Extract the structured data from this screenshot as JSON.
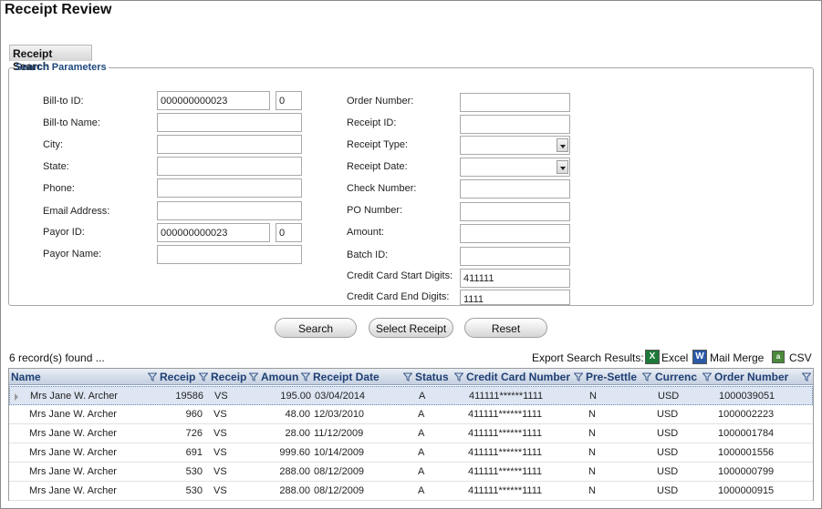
{
  "page": {
    "title": "Receipt Review"
  },
  "tab": {
    "label": "Receipt Search"
  },
  "params": {
    "legend": "Search Parameters",
    "left_fields": [
      {
        "label": "Bill-to ID:",
        "value": "000000000023",
        "sub_value": "0"
      },
      {
        "label": "Bill-to Name:",
        "value": ""
      },
      {
        "label": "City:",
        "value": ""
      },
      {
        "label": "State:",
        "value": ""
      },
      {
        "label": "Phone:",
        "value": ""
      },
      {
        "label": "Email Address:",
        "value": ""
      },
      {
        "label": "Payor ID:",
        "value": "000000000023",
        "sub_value": "0"
      },
      {
        "label": "Payor Name:",
        "value": ""
      }
    ],
    "right_fields": [
      {
        "label": "Order Number:",
        "value": ""
      },
      {
        "label": "Receipt ID:",
        "value": ""
      },
      {
        "label": "Receipt Type:",
        "value": ""
      },
      {
        "label": "Receipt Date:",
        "value": ""
      },
      {
        "label": "Check Number:",
        "value": ""
      },
      {
        "label": "PO Number:",
        "value": ""
      },
      {
        "label": "Amount:",
        "value": ""
      },
      {
        "label": "Batch ID:",
        "value": ""
      },
      {
        "label": "Credit Card Start Digits:",
        "value": "411111"
      },
      {
        "label": "Credit Card End Digits:",
        "value": "1111"
      }
    ]
  },
  "buttons": {
    "search": "Search",
    "select_receipt": "Select Receipt",
    "reset": "Reset"
  },
  "results": {
    "count_text": "6 record(s) found ...",
    "export_label": "Export Search Results:",
    "export_excel": "Excel",
    "export_mail_merge": "Mail Merge",
    "export_csv": "CSV"
  },
  "grid": {
    "columns": [
      "Name",
      "Receip",
      "Receip",
      "Amoun",
      "Receipt Date",
      "Status",
      "Credit Card Number",
      "Pre-Settle",
      "Currenc",
      "Order Number"
    ],
    "rows": [
      [
        "Mrs Jane W. Archer",
        "19586",
        "VS",
        "195.00",
        "03/04/2014",
        "A",
        "411111******1111",
        "N",
        "USD",
        "1000039051"
      ],
      [
        "Mrs Jane W. Archer",
        "960",
        "VS",
        "48.00",
        "12/03/2010",
        "A",
        "411111******1111",
        "N",
        "USD",
        "1000002223"
      ],
      [
        "Mrs Jane W. Archer",
        "726",
        "VS",
        "28.00",
        "11/12/2009",
        "A",
        "411111******1111",
        "N",
        "USD",
        "1000001784"
      ],
      [
        "Mrs Jane W. Archer",
        "691",
        "VS",
        "999.60",
        "10/14/2009",
        "A",
        "411111******1111",
        "N",
        "USD",
        "1000001556"
      ],
      [
        "Mrs Jane W. Archer",
        "530",
        "VS",
        "288.00",
        "08/12/2009",
        "A",
        "411111******1111",
        "N",
        "USD",
        "1000000799"
      ],
      [
        "Mrs Jane W. Archer",
        "530",
        "VS",
        "288.00",
        "08/12/2009",
        "A",
        "411111******1111",
        "N",
        "USD",
        "1000000915"
      ]
    ]
  }
}
